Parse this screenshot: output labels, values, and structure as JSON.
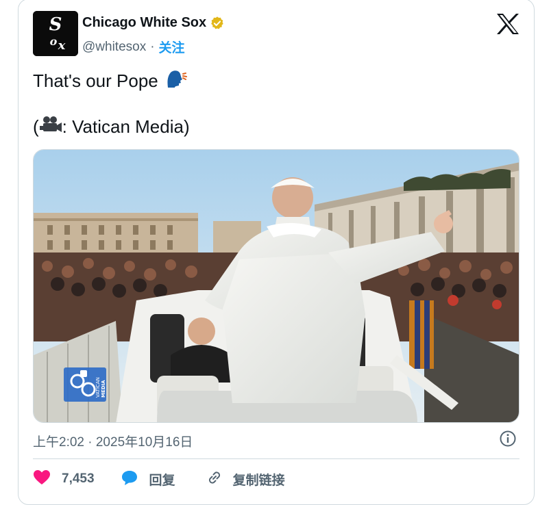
{
  "account": {
    "display_name": "Chicago White Sox",
    "handle": "@whitesox",
    "separator": "·",
    "follow_label": "关注",
    "verified": true,
    "avatar_text": "Sox"
  },
  "tweet": {
    "text_line1": "That's our Pope",
    "text_line2_open": "(",
    "text_line2_rest": ": Vatican Media)",
    "emoji_1": "speaking-head",
    "emoji_2": "movie-camera",
    "timestamp": "上午2:02 · 2025年10月16日"
  },
  "media": {
    "watermark_line1": "VATICAN",
    "watermark_line2": "MEDIA"
  },
  "actions": {
    "likes_count": "7,453",
    "reply_label": "回复",
    "copy_link_label": "复制链接"
  },
  "colors": {
    "accent": "#1d9bf0",
    "like": "#f91880",
    "secondary_text": "#536471",
    "border": "#cfd9de"
  },
  "icons": [
    "x-logo-icon",
    "verified-badge-icon",
    "info-icon",
    "heart-icon",
    "reply-bubble-icon",
    "link-icon"
  ]
}
